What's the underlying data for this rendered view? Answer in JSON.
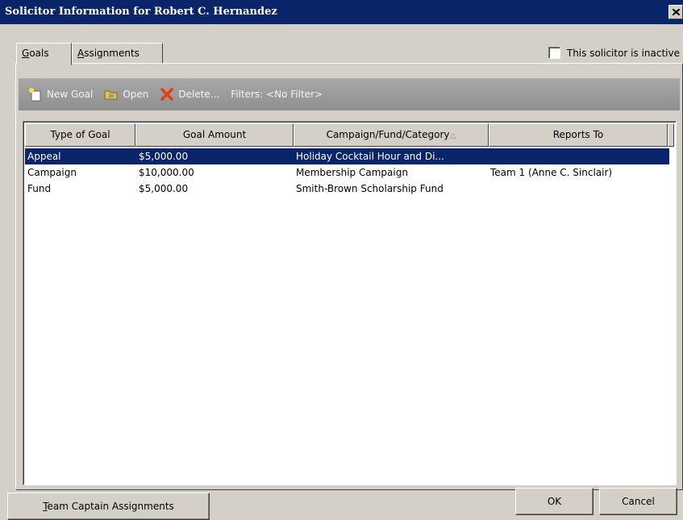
{
  "window": {
    "title": "Solicitor Information for Robert C. Hernandez"
  },
  "tabs": [
    {
      "label_accel": "G",
      "label_rest": "oals",
      "active": true
    },
    {
      "label_accel": "A",
      "label_rest": "ssignments",
      "active": false
    }
  ],
  "inactive_checkbox": {
    "label": "This solicitor is inactive",
    "checked": false
  },
  "toolbar": {
    "new_goal": "New Goal",
    "open": "Open",
    "delete": "Delete...",
    "filters": "Filters: <No Filter>"
  },
  "grid": {
    "columns": [
      "Type of Goal",
      "Goal Amount",
      "Campaign/Fund/Category",
      "Reports To"
    ],
    "sort_indicator": "△",
    "rows": [
      {
        "type": "Appeal",
        "amount": "$5,000.00",
        "cfc": "Holiday Cocktail Hour and Di...",
        "reports_to": "",
        "selected": true
      },
      {
        "type": "Campaign",
        "amount": "$10,000.00",
        "cfc": "Membership Campaign",
        "reports_to": "Team 1 (Anne C. Sinclair)",
        "selected": false
      },
      {
        "type": "Fund",
        "amount": "$5,000.00",
        "cfc": "Smith-Brown Scholarship Fund",
        "reports_to": "",
        "selected": false
      }
    ]
  },
  "buttons": {
    "team_captain_accel": "T",
    "team_captain_rest": "eam Captain Assignments",
    "ok": "OK",
    "cancel": "Cancel"
  },
  "colors": {
    "titlebar": "#0a246a",
    "selection": "#0a246a",
    "face": "#d4d0c8"
  }
}
